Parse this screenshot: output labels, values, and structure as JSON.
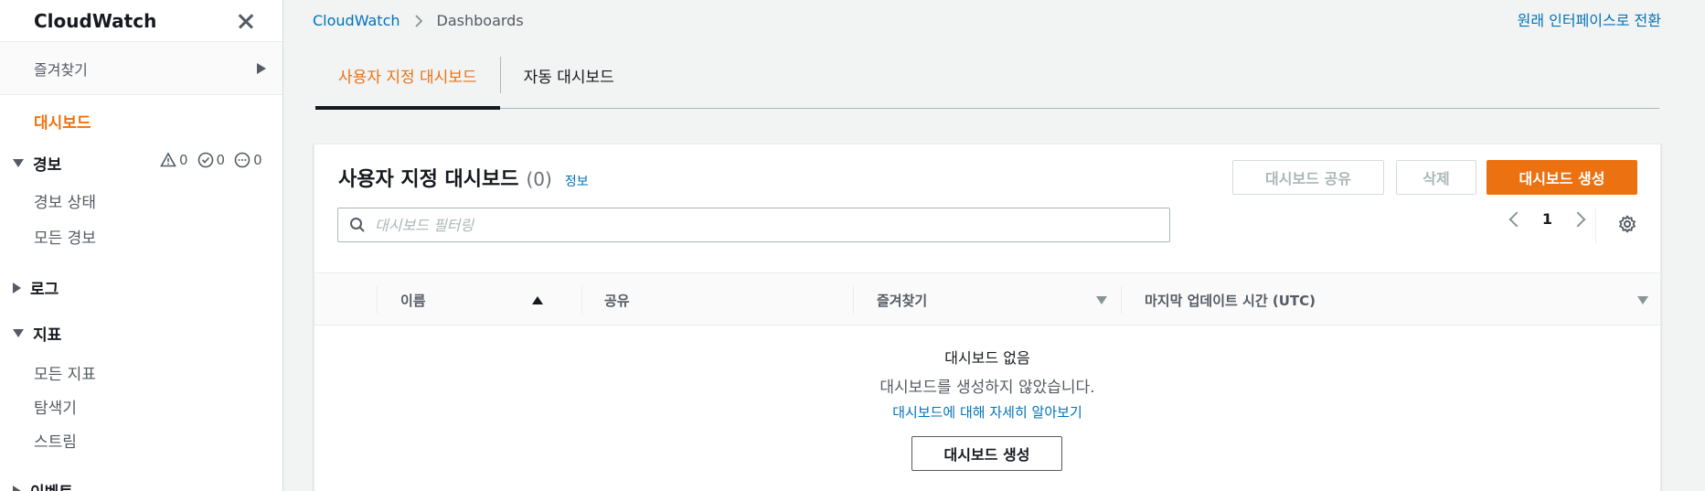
{
  "sidebar": {
    "title": "CloudWatch",
    "favorites_label": "즐겨찾기",
    "active_item": "대시보드",
    "alarms": {
      "label": "경보",
      "counts": [
        "0",
        "0",
        "0"
      ],
      "items": [
        "경보 상태",
        "모든 경보"
      ]
    },
    "logs_label": "로그",
    "metrics": {
      "label": "지표",
      "items": [
        "모든 지표",
        "탐색기",
        "스트림"
      ]
    },
    "events_label": "이벤트"
  },
  "breadcrumb": {
    "root": "CloudWatch",
    "current": "Dashboards"
  },
  "top_link": "원래 인터페이스로 전환",
  "tabs": [
    {
      "label": "사용자 지정 대시보드",
      "active": true
    },
    {
      "label": "자동 대시보드",
      "active": false
    }
  ],
  "panel": {
    "title": "사용자 지정 대시보드",
    "count": "(0)",
    "info_link": "정보",
    "buttons": {
      "share": "대시보드 공유",
      "delete": "삭제",
      "create": "대시보드 생성"
    },
    "search_placeholder": "대시보드 필터링",
    "page": "1",
    "columns": [
      "이름",
      "공유",
      "즐겨찾기",
      "마지막 업데이트 시간 (UTC)"
    ],
    "empty": {
      "title": "대시보드 없음",
      "description": "대시보드를 생성하지 않았습니다.",
      "link": "대시보드에 대해 자세히 알아보기",
      "button": "대시보드 생성"
    }
  },
  "colors": {
    "accent": "#ec7211",
    "link": "#0073bb",
    "text": "#16191f",
    "muted": "#545b64"
  }
}
